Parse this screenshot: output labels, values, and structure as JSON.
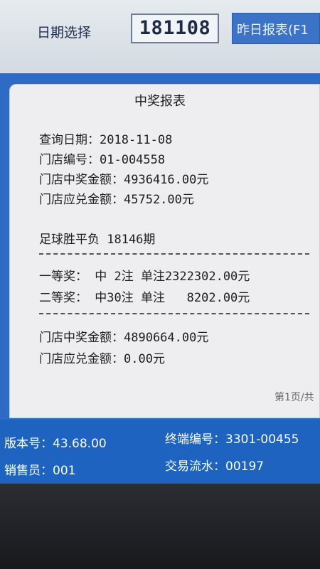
{
  "header": {
    "date_label": "日期选择",
    "date_value": "181108",
    "yesterday_button": "昨日报表(F1"
  },
  "report": {
    "title": "中奖报表",
    "query_date": "查询日期：2018-11-08",
    "store_id": "门店编号：01-004558",
    "store_prize_amount": "门店中奖金额：4936416.00元",
    "store_payable_amount": "门店应兑金额：45752.00元",
    "game": "足球胜平负 18146期",
    "first_prize": "一等奖： 中 2注 单注2322302.00元",
    "second_prize": "二等奖： 中30注 单注   8202.00元",
    "total_prize_amount": "门店中奖金额：4890664.00元",
    "total_payable_amount": "门店应兑金额：0.00元",
    "page_indicator": "第1页/共"
  },
  "status": {
    "version": "版本号：43.68.00",
    "terminal": "终端编号：3301-00455",
    "seller": "销售员：001",
    "transaction": "交易流水：00197"
  }
}
